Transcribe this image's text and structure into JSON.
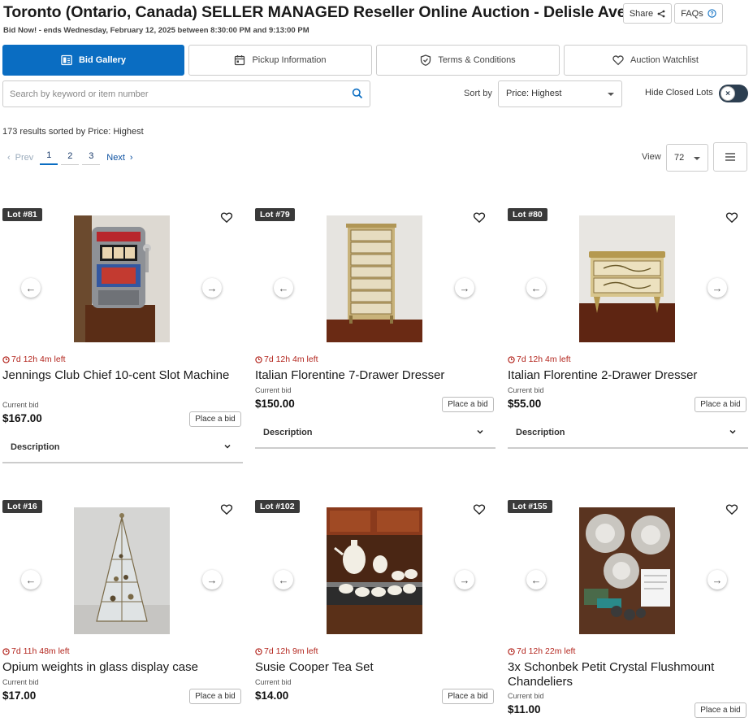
{
  "header": {
    "title": "Toronto (Ontario, Canada) SELLER MANAGED Reseller Online Auction - Delisle Avenue",
    "subtitle": "Bid Now! - ends Wednesday, February 12, 2025 between 8:30:00 PM and 9:13:00 PM",
    "share_label": "Share",
    "faqs_label": "FAQs"
  },
  "tabs": [
    {
      "label": "Bid Gallery",
      "icon": "gallery-icon",
      "active": true
    },
    {
      "label": "Pickup Information",
      "icon": "calendar-icon",
      "active": false
    },
    {
      "label": "Terms & Conditions",
      "icon": "shield-check-icon",
      "active": false
    },
    {
      "label": "Auction Watchlist",
      "icon": "heart-icon",
      "active": false
    }
  ],
  "search": {
    "placeholder": "Search by keyword or item number",
    "value": ""
  },
  "sort": {
    "label": "Sort by",
    "value": "Price: Highest"
  },
  "hide_closed": {
    "label": "Hide Closed Lots",
    "on": true
  },
  "results_text": "173 results sorted by Price: Highest",
  "pagination": {
    "prev": "Prev",
    "pages": [
      "1",
      "2",
      "3"
    ],
    "current": "1",
    "next": "Next"
  },
  "view": {
    "label": "View",
    "value": "72"
  },
  "colors": {
    "accent": "#0a6dc2",
    "timer": "#b3261e",
    "badge": "#3a3a3a"
  },
  "lots": [
    {
      "badge": "Lot #81",
      "time_left": "7d 12h 4m left",
      "title": "Jennings Club Chief 10-cent Slot Machine",
      "bid_label": "Current bid",
      "bid": "$167.00",
      "button": "Place a bid",
      "description": "Description"
    },
    {
      "badge": "Lot #79",
      "time_left": "7d 12h 4m left",
      "title": "Italian Florentine 7-Drawer Dresser",
      "bid_label": "Current bid",
      "bid": "$150.00",
      "button": "Place a bid",
      "description": "Description"
    },
    {
      "badge": "Lot #80",
      "time_left": "7d 12h 4m left",
      "title": "Italian Florentine 2-Drawer Dresser",
      "bid_label": "Current bid",
      "bid": "$55.00",
      "button": "Place a bid",
      "description": "Description"
    },
    {
      "badge": "Lot #16",
      "time_left": "7d 11h 48m left",
      "title": "Opium weights in glass display case",
      "bid_label": "Current bid",
      "bid": "$17.00",
      "button": "Place a bid"
    },
    {
      "badge": "Lot #102",
      "time_left": "7d 12h 9m left",
      "title": "Susie Cooper Tea Set",
      "bid_label": "Current bid",
      "bid": "$14.00",
      "button": "Place a bid"
    },
    {
      "badge": "Lot #155",
      "time_left": "7d 12h 22m left",
      "title": "3x Schonbek Petit Crystal Flushmount Chandeliers",
      "bid_label": "Current bid",
      "bid": "$11.00",
      "button": "Place a bid"
    }
  ]
}
